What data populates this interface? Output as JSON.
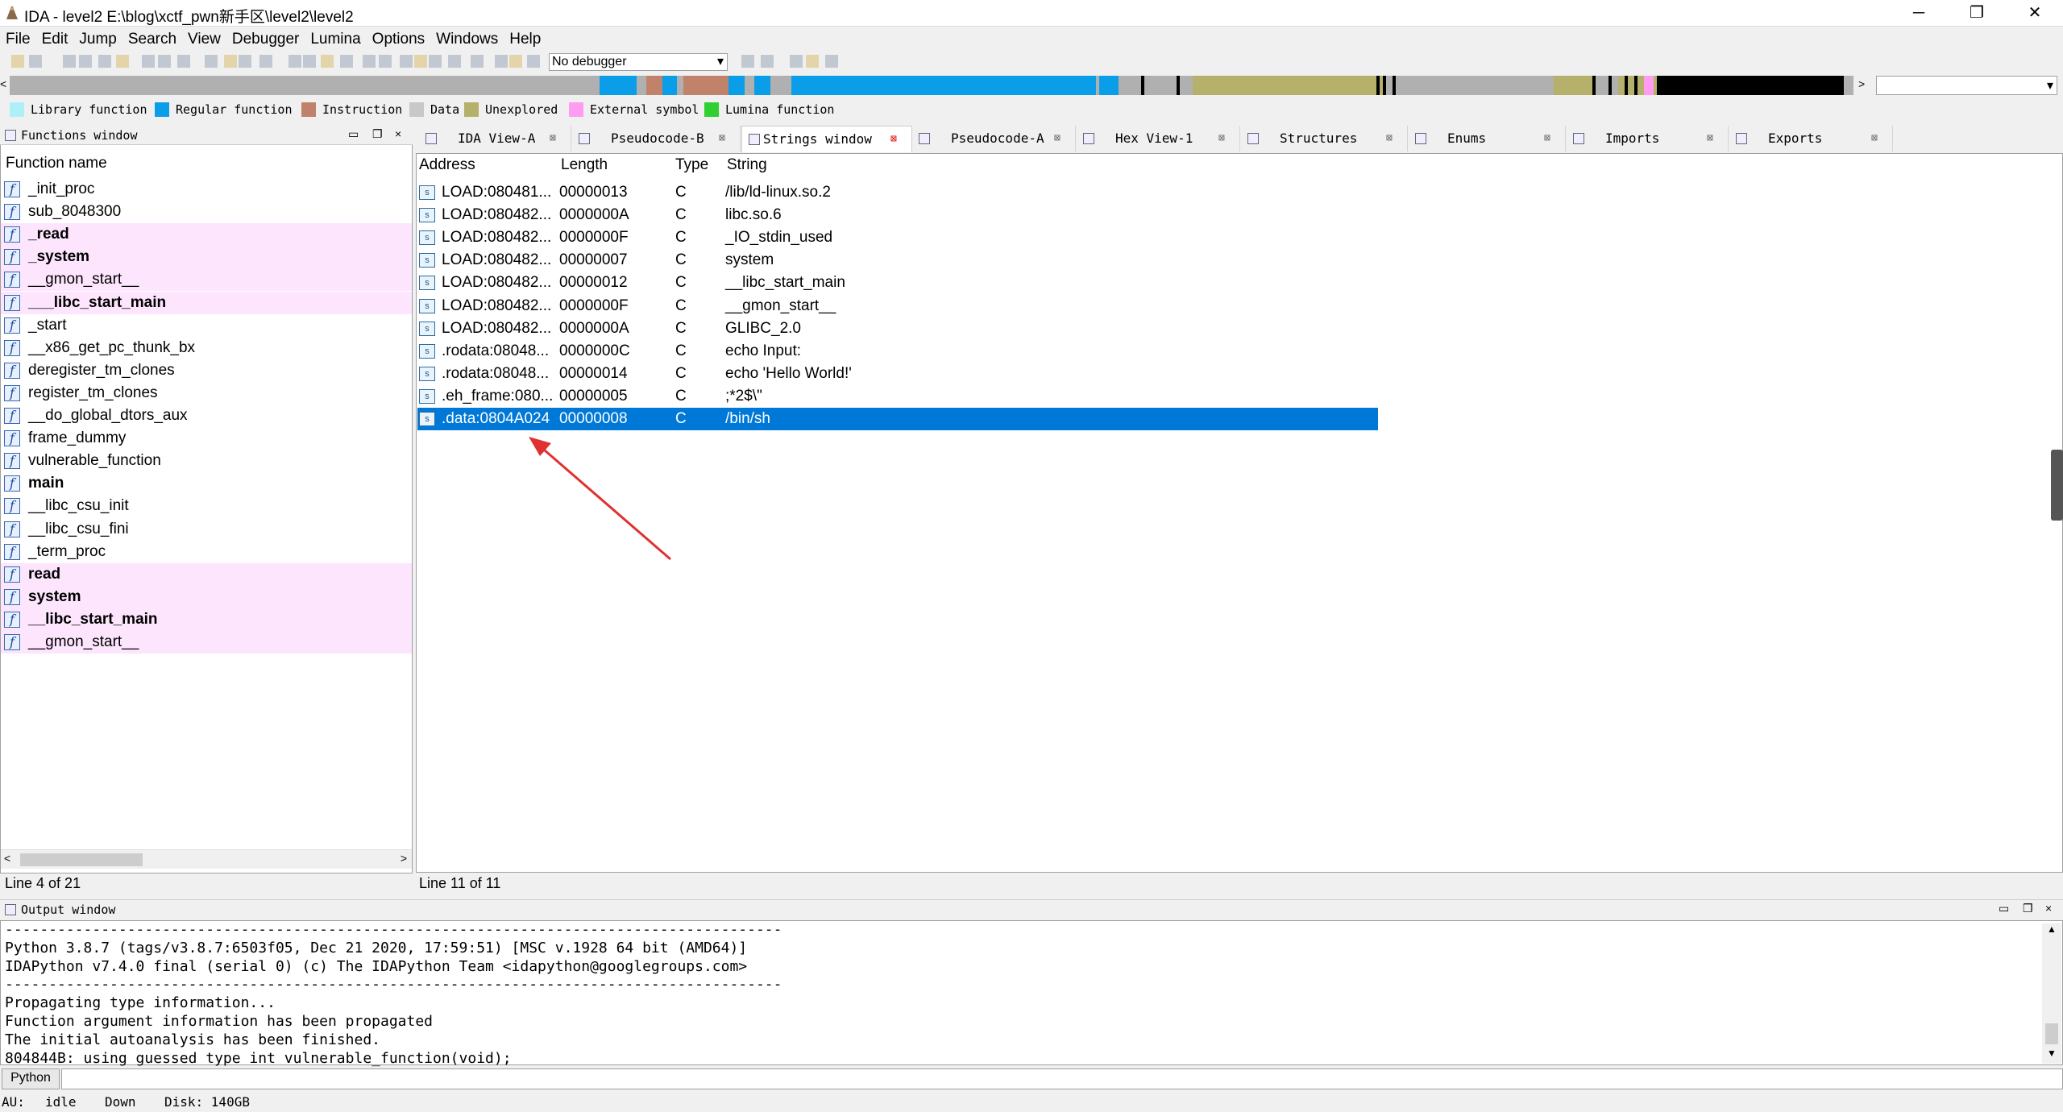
{
  "window": {
    "title": "IDA - level2 E:\\blog\\xctf_pwn新手区\\level2\\level2",
    "minimize": "─",
    "maximize": "❐",
    "close": "✕"
  },
  "menu": [
    "File",
    "Edit",
    "Jump",
    "Search",
    "View",
    "Debugger",
    "Lumina",
    "Options",
    "Windows",
    "Help"
  ],
  "toolbar": {
    "debugger_select": "No debugger"
  },
  "legend": [
    {
      "label": "Library function",
      "color": "#aef0f8"
    },
    {
      "label": "Regular function",
      "color": "#0a9ee8"
    },
    {
      "label": "Instruction",
      "color": "#c0826a"
    },
    {
      "label": "Data",
      "color": "#c8c8c8"
    },
    {
      "label": "Unexplored",
      "color": "#b5b06a"
    },
    {
      "label": "External symbol",
      "color": "#ff9cf2"
    },
    {
      "label": "Lumina function",
      "color": "#30d030"
    }
  ],
  "functions_window": {
    "title": "Functions window",
    "column_header": "Function name",
    "icon_glyph": "f",
    "items": [
      {
        "name": "_init_proc",
        "bold": false,
        "highlight": false
      },
      {
        "name": "sub_8048300",
        "bold": false,
        "highlight": false
      },
      {
        "name": "_read",
        "bold": true,
        "highlight": true
      },
      {
        "name": "_system",
        "bold": true,
        "highlight": true
      },
      {
        "name": "__gmon_start__",
        "bold": false,
        "highlight": true
      },
      {
        "name": "___libc_start_main",
        "bold": true,
        "highlight": true
      },
      {
        "name": "_start",
        "bold": false,
        "highlight": false
      },
      {
        "name": "__x86_get_pc_thunk_bx",
        "bold": false,
        "highlight": false
      },
      {
        "name": "deregister_tm_clones",
        "bold": false,
        "highlight": false
      },
      {
        "name": "register_tm_clones",
        "bold": false,
        "highlight": false
      },
      {
        "name": "__do_global_dtors_aux",
        "bold": false,
        "highlight": false
      },
      {
        "name": "frame_dummy",
        "bold": false,
        "highlight": false
      },
      {
        "name": "vulnerable_function",
        "bold": false,
        "highlight": false
      },
      {
        "name": "main",
        "bold": true,
        "highlight": false
      },
      {
        "name": "__libc_csu_init",
        "bold": false,
        "highlight": false
      },
      {
        "name": "__libc_csu_fini",
        "bold": false,
        "highlight": false
      },
      {
        "name": "_term_proc",
        "bold": false,
        "highlight": false
      },
      {
        "name": "read",
        "bold": true,
        "highlight": true
      },
      {
        "name": "system",
        "bold": true,
        "highlight": true
      },
      {
        "name": "__libc_start_main",
        "bold": true,
        "highlight": true
      },
      {
        "name": "__gmon_start__",
        "bold": false,
        "highlight": true
      }
    ],
    "status": "Line 4 of 21"
  },
  "tabs": [
    {
      "label": "IDA View-A",
      "active": false
    },
    {
      "label": "Pseudocode-B",
      "active": false
    },
    {
      "label": "Strings window",
      "active": true
    },
    {
      "label": "Pseudocode-A",
      "active": false
    },
    {
      "label": "Hex View-1",
      "active": false
    },
    {
      "label": "Structures",
      "active": false
    },
    {
      "label": "Enums",
      "active": false
    },
    {
      "label": "Imports",
      "active": false
    },
    {
      "label": "Exports",
      "active": false
    }
  ],
  "strings_window": {
    "columns": [
      "Address",
      "Length",
      "Type",
      "String"
    ],
    "icon_glyph": "s",
    "rows": [
      {
        "address": "LOAD:080481...",
        "length": "00000013",
        "type": "C",
        "string": "/lib/ld-linux.so.2"
      },
      {
        "address": "LOAD:080482...",
        "length": "0000000A",
        "type": "C",
        "string": "libc.so.6"
      },
      {
        "address": "LOAD:080482...",
        "length": "0000000F",
        "type": "C",
        "string": "_IO_stdin_used"
      },
      {
        "address": "LOAD:080482...",
        "length": "00000007",
        "type": "C",
        "string": "system"
      },
      {
        "address": "LOAD:080482...",
        "length": "00000012",
        "type": "C",
        "string": "__libc_start_main"
      },
      {
        "address": "LOAD:080482...",
        "length": "0000000F",
        "type": "C",
        "string": "__gmon_start__"
      },
      {
        "address": "LOAD:080482...",
        "length": "0000000A",
        "type": "C",
        "string": "GLIBC_2.0"
      },
      {
        "address": ".rodata:08048...",
        "length": "0000000C",
        "type": "C",
        "string": "echo Input:"
      },
      {
        "address": ".rodata:08048...",
        "length": "00000014",
        "type": "C",
        "string": "echo 'Hello World!'"
      },
      {
        "address": ".eh_frame:080...",
        "length": "00000005",
        "type": "C",
        "string": ";*2$\\\""
      },
      {
        "address": ".data:0804A024",
        "length": "00000008",
        "type": "C",
        "string": "/bin/sh"
      }
    ],
    "selected_index": 10,
    "status": "Line 11 of 11"
  },
  "output_window": {
    "title": "Output window",
    "lines": [
      "-----------------------------------------------------------------------------------------",
      "Python 3.8.7 (tags/v3.8.7:6503f05, Dec 21 2020, 17:59:51) [MSC v.1928 64 bit (AMD64)]",
      "IDAPython v7.4.0 final (serial 0) (c) The IDAPython Team <idapython@googlegroups.com>",
      "-----------------------------------------------------------------------------------------",
      "Propagating type information...",
      "Function argument information has been propagated",
      "The initial autoanalysis has been finished.",
      "804844B: using guessed type int vulnerable_function(void);"
    ]
  },
  "python_bar": {
    "button": "Python",
    "input_value": ""
  },
  "statusbar": {
    "au_label": "AU:",
    "au_state": "idle",
    "scroll": "Down",
    "disk": "Disk: 140GB"
  },
  "icons": {
    "panel_float": "❐",
    "panel_restore": "▭",
    "panel_close": "×",
    "tab_close": "⊠",
    "scroll_left": "<",
    "scroll_right": ">",
    "scroll_up": "▲",
    "scroll_down": "▼",
    "dropdown": "▾"
  }
}
